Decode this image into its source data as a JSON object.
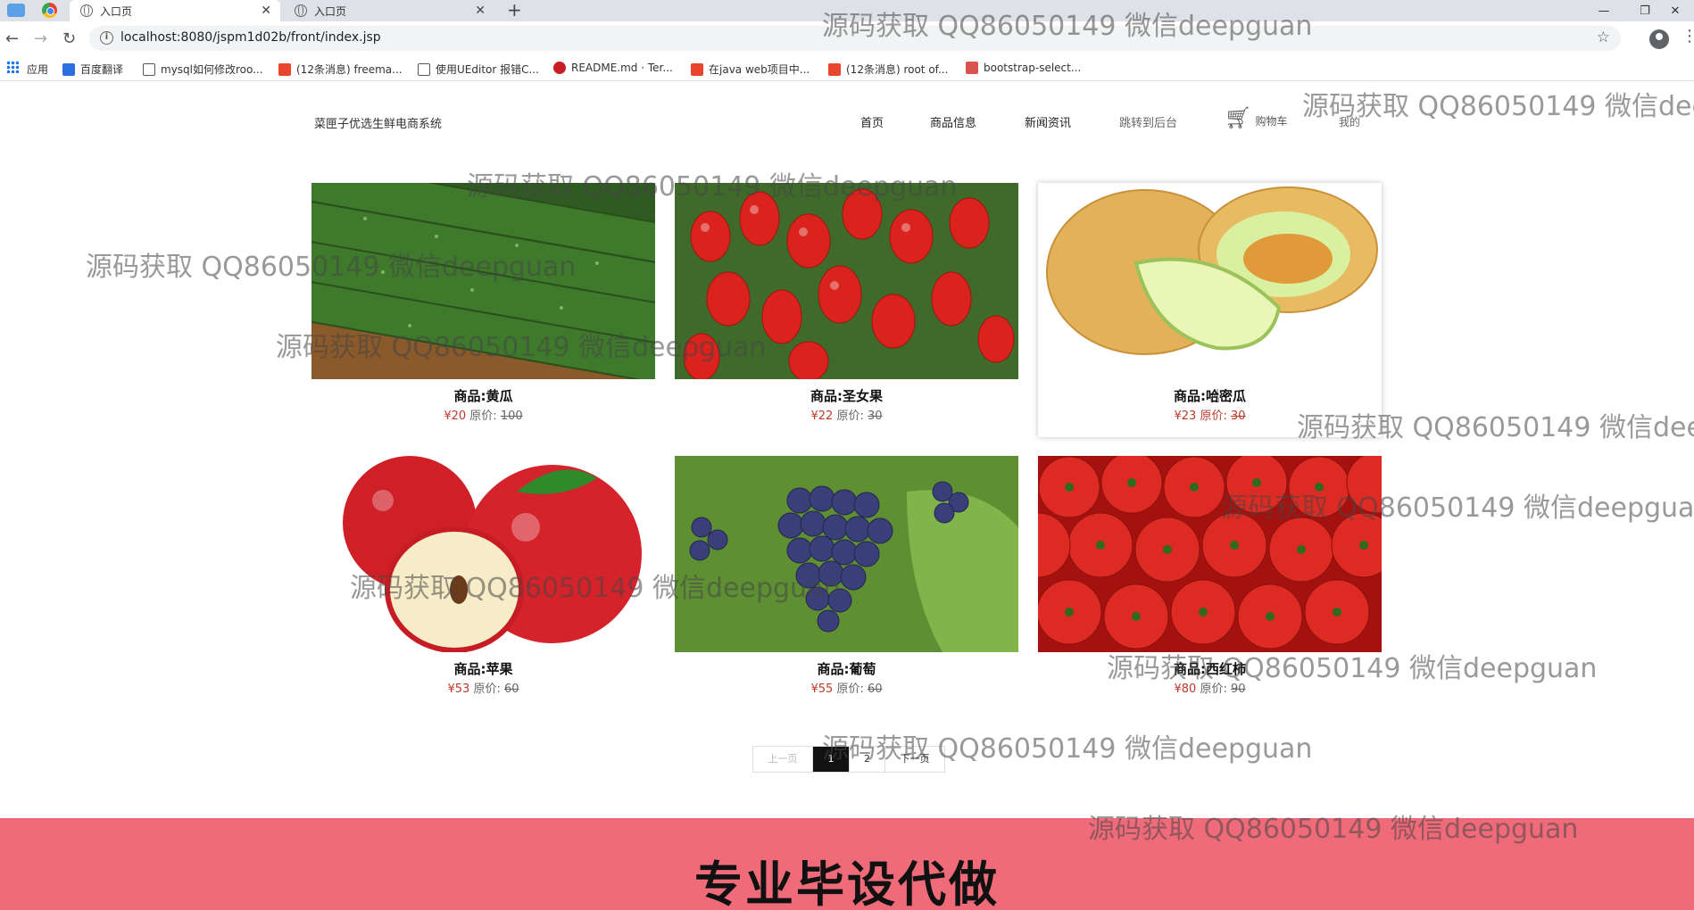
{
  "browser": {
    "tabs": [
      {
        "title": "入口页"
      },
      {
        "title": "入口页"
      }
    ],
    "new_tab_label": "+",
    "window_controls": {
      "minimize": "—",
      "restore": "❐",
      "close": "✕"
    },
    "url": "localhost:8080/jspm1d02b/front/index.jsp",
    "bookmarks": [
      {
        "label": "应用",
        "icon": "apps-grid-icon",
        "color": "#1a73e8"
      },
      {
        "label": "百度翻译",
        "icon": "baidu-translate-icon",
        "color": "#2b6fe0"
      },
      {
        "label": "mysql如何修改roo...",
        "icon": "mysql-icon",
        "color": "#555555"
      },
      {
        "label": "(12条消息) freema...",
        "icon": "csdn-icon",
        "color": "#e8452c"
      },
      {
        "label": "使用UEditor 报错C...",
        "icon": "ueditor-icon",
        "color": "#555555"
      },
      {
        "label": "README.md · Ter...",
        "icon": "gitee-icon",
        "color": "#c71d23"
      },
      {
        "label": "在java web项目中...",
        "icon": "csdn-icon",
        "color": "#e8452c"
      },
      {
        "label": "(12条消息) root of...",
        "icon": "csdn-icon",
        "color": "#e8452c"
      },
      {
        "label": "bootstrap-select...",
        "icon": "cnblogs-icon",
        "color": "#d9534f"
      }
    ]
  },
  "site": {
    "brand": "菜匣子优选生鲜电商系统",
    "nav": [
      "首页",
      "商品信息",
      "新闻资讯",
      "跳转到后台"
    ],
    "cart_label": "购物车",
    "mine_label": "我的"
  },
  "products": [
    {
      "name": "商品:黄瓜",
      "price": "¥20",
      "orig_label": "原价:",
      "orig": "100",
      "image": "cucumber"
    },
    {
      "name": "商品:圣女果",
      "price": "¥22",
      "orig_label": "原价:",
      "orig": "30",
      "image": "cherry-tomato"
    },
    {
      "name": "商品:哈密瓜",
      "price": "¥23",
      "orig_label": "原价:",
      "orig": "30",
      "image": "cantaloupe"
    },
    {
      "name": "商品:苹果",
      "price": "¥53",
      "orig_label": "原价:",
      "orig": "60",
      "image": "apple"
    },
    {
      "name": "商品:葡萄",
      "price": "¥55",
      "orig_label": "原价:",
      "orig": "60",
      "image": "grape"
    },
    {
      "name": "商品:西红柿",
      "price": "¥80",
      "orig_label": "原价:",
      "orig": "90",
      "image": "tomato"
    }
  ],
  "pagination": {
    "prev": "上一页",
    "pages": [
      "1",
      "2"
    ],
    "current": "1",
    "next": "下一页"
  },
  "banner": "专业毕设代做",
  "watermark": "源码获取 QQ86050149 微信deepguan"
}
